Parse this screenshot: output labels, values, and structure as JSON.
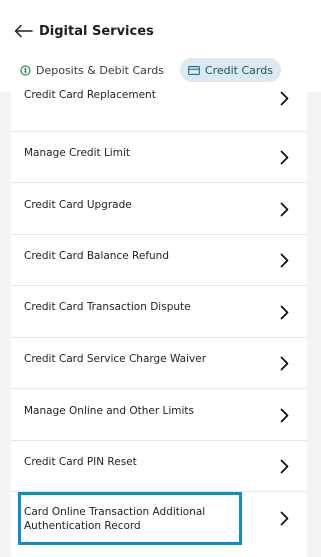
{
  "header": {
    "title": "Digital Services"
  },
  "tabs": [
    {
      "label": "Deposits & Debit Cards",
      "active": false
    },
    {
      "label": "Credit Cards",
      "active": true
    }
  ],
  "services": [
    {
      "label": "Credit Card Replacement"
    },
    {
      "label": "Manage Credit Limit"
    },
    {
      "label": "Credit Card Upgrade"
    },
    {
      "label": "Credit Card Balance Refund"
    },
    {
      "label": "Credit Card Transaction Dispute"
    },
    {
      "label": "Credit Card Service Charge Waiver"
    },
    {
      "label": "Manage Online and Other Limits"
    },
    {
      "label": "Credit Card PIN Reset"
    },
    {
      "label": "Card Online Transaction Additional Authentication Record",
      "highlighted": true
    }
  ],
  "colors": {
    "active_tab_bg": "#dde9f0",
    "active_tab_text": "#1f4f66",
    "highlight_border": "#0b8ecd",
    "deposit_icon": "#2c8c5a"
  }
}
